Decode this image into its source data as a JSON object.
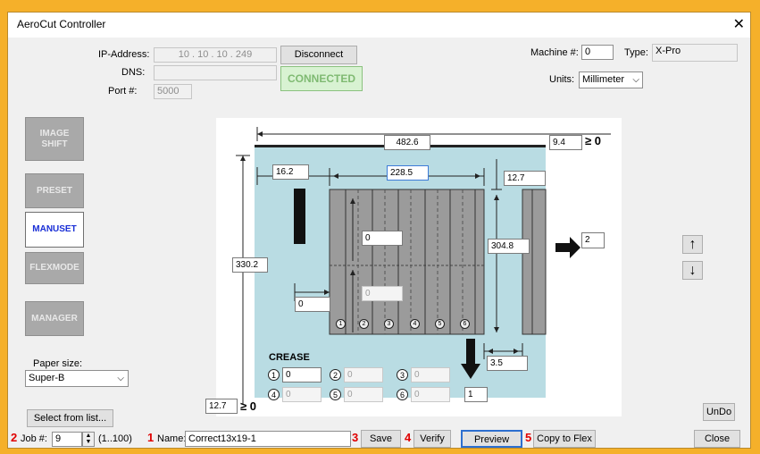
{
  "window": {
    "title": "AeroCut Controller",
    "close_glyph": "✕"
  },
  "connection": {
    "ip_label": "IP-Address:",
    "ip_value": "10  .  10  .  10  .  249",
    "dns_label": "DNS:",
    "dns_value": "",
    "port_label": "Port #:",
    "port_value": "5000",
    "disconnect_label": "Disconnect",
    "status": "CONNECTED"
  },
  "machine": {
    "machine_label": "Machine #:",
    "machine_value": "0",
    "type_label": "Type:",
    "type_value": "X-Pro",
    "units_label": "Units:",
    "units_value": "Millimeter"
  },
  "sidebar": {
    "items": [
      {
        "label": "IMAGE SHIFT",
        "active": false
      },
      {
        "label": "PRESET",
        "active": false
      },
      {
        "label": "MANUSET",
        "active": true
      },
      {
        "label": "FLEXMODE",
        "active": false
      },
      {
        "label": "MANAGER",
        "active": false
      }
    ]
  },
  "paper": {
    "label": "Paper size:",
    "value": "Super-B",
    "select_from_list": "Select from list..."
  },
  "diagram": {
    "sheet_width": "482.6",
    "right_margin": "9.4",
    "right_margin_note": "≥ 0",
    "lead_margin": "16.2",
    "card_width": "228.5",
    "top_margin": "12.7",
    "sheet_height": "330.2",
    "card_height": "304.8",
    "offset_a": "0",
    "offset_b": "0",
    "offset_c": "0",
    "gap": "3.5",
    "columns": "2",
    "bottom_margin": "12.7",
    "bottom_margin_note": "≥ 0",
    "crease_title": "CREASE",
    "crease_numbers": [
      "1",
      "2",
      "3",
      "4",
      "5",
      "6"
    ],
    "crease_values": [
      "0",
      "0",
      "0",
      "0",
      "0",
      "0"
    ],
    "crease_count": "1"
  },
  "arrows": {
    "up": "↑",
    "down": "↓"
  },
  "footer": {
    "markers": [
      "2",
      "1",
      "3",
      "4",
      "5"
    ],
    "job_label": "Job #:",
    "job_value": "9",
    "job_range": "(1..100)",
    "name_label": "Name:",
    "name_value": "Correct13x19-1",
    "save": "Save",
    "verify": "Verify",
    "preview": "Preview",
    "copy_to_flex": "Copy to Flex",
    "undo": "UnDo",
    "close": "Close"
  }
}
